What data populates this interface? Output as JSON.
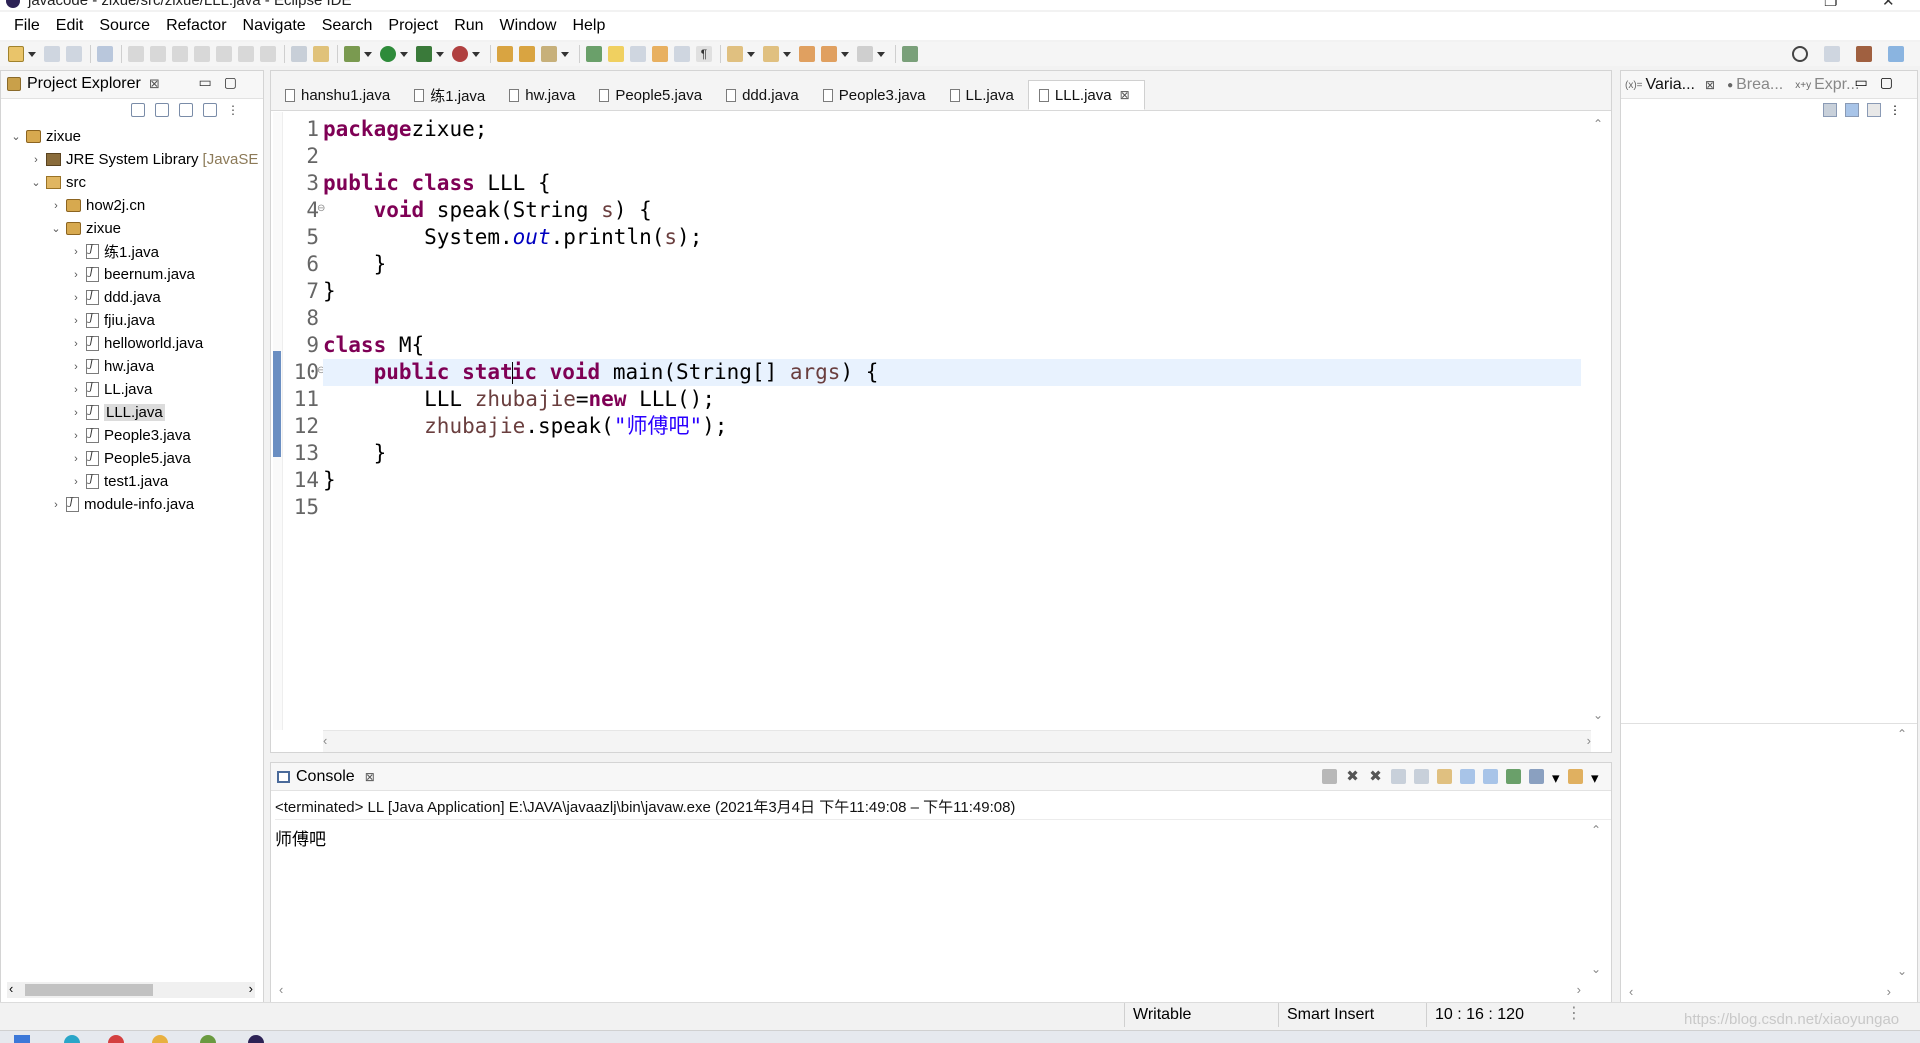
{
  "window": {
    "title": "javacode - zixue/src/zixue/LLL.java - Eclipse IDE"
  },
  "menu": [
    "File",
    "Edit",
    "Source",
    "Refactor",
    "Navigate",
    "Search",
    "Project",
    "Run",
    "Window",
    "Help"
  ],
  "explorer": {
    "title": "Project Explorer",
    "tree": [
      {
        "label": "zixue",
        "indent": 0,
        "expanded": true,
        "icon": "project-icon"
      },
      {
        "label": "JRE System Library",
        "suffix": "[JavaSE",
        "indent": 1,
        "expanded": false,
        "icon": "library-icon"
      },
      {
        "label": "src",
        "indent": 1,
        "expanded": true,
        "icon": "source-folder-icon"
      },
      {
        "label": "how2j.cn",
        "indent": 2,
        "expanded": false,
        "icon": "package-icon"
      },
      {
        "label": "zixue",
        "indent": 2,
        "expanded": true,
        "icon": "package-icon"
      },
      {
        "label": "练1.java",
        "indent": 3,
        "expanded": false,
        "icon": "java-file-icon"
      },
      {
        "label": "beernum.java",
        "indent": 3,
        "expanded": false,
        "icon": "java-file-icon"
      },
      {
        "label": "ddd.java",
        "indent": 3,
        "expanded": false,
        "icon": "java-file-icon"
      },
      {
        "label": "fjiu.java",
        "indent": 3,
        "expanded": false,
        "icon": "java-file-icon"
      },
      {
        "label": "helloworld.java",
        "indent": 3,
        "expanded": false,
        "icon": "java-file-icon"
      },
      {
        "label": "hw.java",
        "indent": 3,
        "expanded": false,
        "icon": "java-file-icon"
      },
      {
        "label": "LL.java",
        "indent": 3,
        "expanded": false,
        "icon": "java-file-icon"
      },
      {
        "label": "LLL.java",
        "indent": 3,
        "expanded": false,
        "icon": "java-file-icon",
        "selected": true
      },
      {
        "label": "People3.java",
        "indent": 3,
        "expanded": false,
        "icon": "java-file-icon"
      },
      {
        "label": "People5.java",
        "indent": 3,
        "expanded": false,
        "icon": "java-file-icon"
      },
      {
        "label": "test1.java",
        "indent": 3,
        "expanded": false,
        "icon": "java-file-icon"
      },
      {
        "label": "module-info.java",
        "indent": 2,
        "expanded": false,
        "icon": "java-file-icon"
      }
    ]
  },
  "editor": {
    "tabs": [
      {
        "label": "hanshu1.java"
      },
      {
        "label": "练1.java"
      },
      {
        "label": "hw.java"
      },
      {
        "label": "People5.java"
      },
      {
        "label": "ddd.java"
      },
      {
        "label": "People3.java"
      },
      {
        "label": "LL.java"
      },
      {
        "label": "LLL.java",
        "active": true
      }
    ],
    "lines": [
      {
        "n": "1",
        "tokens": [
          [
            "kw",
            "package"
          ],
          [
            "",
            "zixue;"
          ]
        ]
      },
      {
        "n": "2",
        "tokens": []
      },
      {
        "n": "3",
        "tokens": [
          [
            "kw",
            "public"
          ],
          [
            "",
            " "
          ],
          [
            "kw",
            "class"
          ],
          [
            "",
            " LLL {"
          ]
        ]
      },
      {
        "n": "4",
        "fold": true,
        "tokens": [
          [
            "",
            "    "
          ],
          [
            "kw",
            "void"
          ],
          [
            "",
            " speak(String "
          ],
          [
            "var",
            "s"
          ],
          [
            "",
            ") {"
          ]
        ]
      },
      {
        "n": "5",
        "tokens": [
          [
            "",
            "        System."
          ],
          [
            "fld",
            "out"
          ],
          [
            "",
            ".println("
          ],
          [
            "var",
            "s"
          ],
          [
            "",
            ");"
          ]
        ]
      },
      {
        "n": "6",
        "tokens": [
          [
            "",
            "    }"
          ]
        ]
      },
      {
        "n": "7",
        "tokens": [
          [
            "",
            "}"
          ]
        ]
      },
      {
        "n": "8",
        "tokens": []
      },
      {
        "n": "9",
        "tokens": [
          [
            "kw",
            "class"
          ],
          [
            "",
            " M{"
          ]
        ]
      },
      {
        "n": "10",
        "fold": true,
        "current": true,
        "tokens": [
          [
            "",
            "    "
          ],
          [
            "kw",
            "public"
          ],
          [
            "",
            " "
          ],
          [
            "kw",
            "stat"
          ],
          [
            "caret",
            ""
          ],
          [
            "kw",
            "ic"
          ],
          [
            "",
            " "
          ],
          [
            "kw",
            "void"
          ],
          [
            "",
            " main(String[] "
          ],
          [
            "var",
            "args"
          ],
          [
            "",
            ") {"
          ]
        ]
      },
      {
        "n": "11",
        "tokens": [
          [
            "",
            "        LLL "
          ],
          [
            "var",
            "zhubajie"
          ],
          [
            "",
            "="
          ],
          [
            "kw",
            "new"
          ],
          [
            "",
            " LLL();"
          ]
        ]
      },
      {
        "n": "12",
        "tokens": [
          [
            "",
            "        "
          ],
          [
            "var",
            "zhubajie"
          ],
          [
            "",
            ".speak("
          ],
          [
            "str",
            "\"师傅吧\""
          ],
          [
            "",
            ");"
          ]
        ]
      },
      {
        "n": "13",
        "tokens": [
          [
            "",
            "    }"
          ]
        ]
      },
      {
        "n": "14",
        "tokens": [
          [
            "",
            "}"
          ]
        ]
      },
      {
        "n": "15",
        "tokens": []
      }
    ]
  },
  "console": {
    "title": "Console",
    "terminated": "<terminated> LL [Java Application] E:\\JAVA\\javaazlj\\bin\\javaw.exe  (2021年3月4日 下午11:49:08 – 下午11:49:08)",
    "output": "师傅吧"
  },
  "rightpanel": {
    "tabs": [
      {
        "label": "Varia...",
        "icon": "(x)=",
        "active": true
      },
      {
        "label": "Brea...",
        "icon": "●",
        "active": false
      },
      {
        "label": "Expr...",
        "icon": "x+y",
        "active": false
      }
    ]
  },
  "status": {
    "writable": "Writable",
    "insert": "Smart Insert",
    "position": "10 : 16 : 120",
    "watermark": "https://blog.csdn.net/xiaoyungao"
  },
  "colors": {
    "keyword": "#7f0055",
    "field": "#0000c0",
    "variable": "#6a3e3e",
    "string": "#2a00ff",
    "current_line": "#e8f2fe"
  }
}
